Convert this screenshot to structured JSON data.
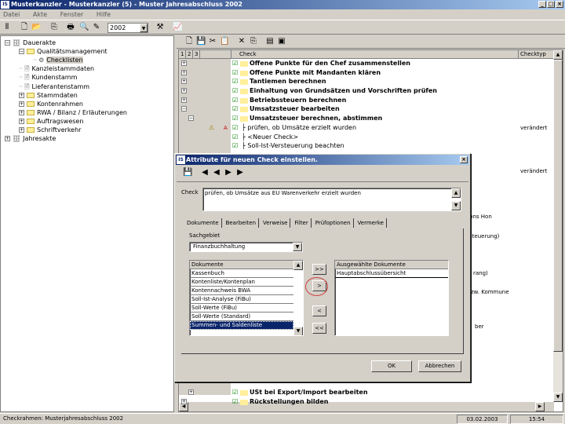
{
  "window": {
    "title": "Musterkanzler - Musterkanzler (5) - Muster Jahresabschluss 2002",
    "logo": "IS",
    "minimize": "_",
    "maximize": "□",
    "close": "×"
  },
  "menu": [
    "Datei",
    "Akte",
    "Fenster",
    "Hilfe"
  ],
  "toolbar": {
    "year": "2002"
  },
  "tree": [
    {
      "label": "Dauerakte",
      "depth": 0,
      "expander": "−",
      "icon": "cabinet"
    },
    {
      "label": "Qualitätsmanagement",
      "depth": 1,
      "expander": "−",
      "icon": "folder"
    },
    {
      "label": "Checklisten",
      "depth": 2,
      "expander": "",
      "icon": "gear",
      "selected": true
    },
    {
      "label": "Kanzleistammdaten",
      "depth": 1,
      "expander": "",
      "icon": "document"
    },
    {
      "label": "Kundenstamm",
      "depth": 1,
      "expander": "",
      "icon": "document"
    },
    {
      "label": "Lieferantenstamm",
      "depth": 1,
      "expander": "",
      "icon": "document"
    },
    {
      "label": "Stammdaten",
      "depth": 1,
      "expander": "+",
      "icon": "folder"
    },
    {
      "label": "Kontenrahmen",
      "depth": 1,
      "expander": "+",
      "icon": "folder"
    },
    {
      "label": "RWA / Bilanz / Erläuterungen",
      "depth": 1,
      "expander": "+",
      "icon": "folder"
    },
    {
      "label": "Auftragswesen",
      "depth": 1,
      "expander": "+",
      "icon": "folder"
    },
    {
      "label": "Schriftverkehr",
      "depth": 1,
      "expander": "+",
      "icon": "folder"
    },
    {
      "label": "Jahresakte",
      "depth": 0,
      "expander": "+",
      "icon": "cabinet"
    }
  ],
  "grid": {
    "headers": {
      "levels": [
        "1",
        "2",
        "3"
      ],
      "check": "Check",
      "checktype": "Checktyp"
    },
    "rows": [
      {
        "text": "Offene Punkte für den Chef zusammenstellen",
        "bold": true,
        "expander": "+",
        "folder": true
      },
      {
        "text": "Offene Punkte mit Mandanten klären",
        "bold": true,
        "expander": "+",
        "folder": true
      },
      {
        "text": "Tantiemen berechnen",
        "bold": true,
        "expander": "+",
        "folder": true
      },
      {
        "text": "Einhaltung von Grundsätzen und Vorschriften prüfen",
        "bold": true,
        "expander": "+",
        "folder": true
      },
      {
        "text": "Betriebssteuern berechnen",
        "bold": true,
        "expander": "+",
        "folder": true
      },
      {
        "text": "Umsatzsteuer bearbeiten",
        "bold": true,
        "expander": "−",
        "folder": true
      },
      {
        "text": "Umsatzsteuer berechnen, abstimmen",
        "bold": true,
        "expander": "−",
        "folder": true,
        "indent": true
      },
      {
        "text": "prüfen, ob Umsätze erzielt wurden",
        "bold": false,
        "checktype": "verändert",
        "leaf": true
      },
      {
        "text": "<Neuer Check>",
        "bold": false,
        "leaf": true
      },
      {
        "text": "Soll-Ist-Versteuerung beachten",
        "bold": false,
        "leaf": true
      }
    ],
    "partial_rows": [
      "verändert",
      "ntons Hon",
      "steuerung)",
      "rang)",
      "zw. Kommune",
      "ber"
    ],
    "bottom_rows": [
      {
        "text": "USt bei Export/Import bearbeiten",
        "expander": "+",
        "indent": true
      },
      {
        "text": "Rückstellungen bilden",
        "expander": "+"
      }
    ]
  },
  "dialog": {
    "title": "Attribute für neuen Check einstellen.",
    "check_label": "Check",
    "check_value": "prüfen, ob Umsätze aus EU Warenverkehr erzielt wurden",
    "tabs": [
      "Dokumente",
      "Bearbeiten",
      "Verweise",
      "Filter",
      "Prüfoptionen",
      "Vermerke"
    ],
    "active_tab": "Dokumente",
    "sachgebiet_label": "Sachgebiet",
    "sachgebiet_value": "Finanzbuchhaltung",
    "documents_header": "Dokumente",
    "documents": [
      "Kassenbuch",
      "Kontenliste/Kontenplan",
      "Kontennachweis BWA",
      "Soll-Ist-Analyse (FiBu)",
      "Soll-Werte (FiBu)",
      "Soll-Werte (Standard)",
      "Summen- und Saldenliste"
    ],
    "selected_document": "Summen- und Saldenliste",
    "selected_header": "Ausgewählte Dokumente",
    "selected_documents": [
      "Hauptabschlussübersicht"
    ],
    "buttons": {
      "add_all": ">>",
      "add": ">",
      "remove": "<",
      "remove_all": "<<",
      "ok": "OK",
      "cancel": "Abbrechen"
    }
  },
  "status": {
    "text": "Checkrahmen: Musterjahresabschluss 2002",
    "date": "03.02.2003",
    "time": "15:54"
  }
}
